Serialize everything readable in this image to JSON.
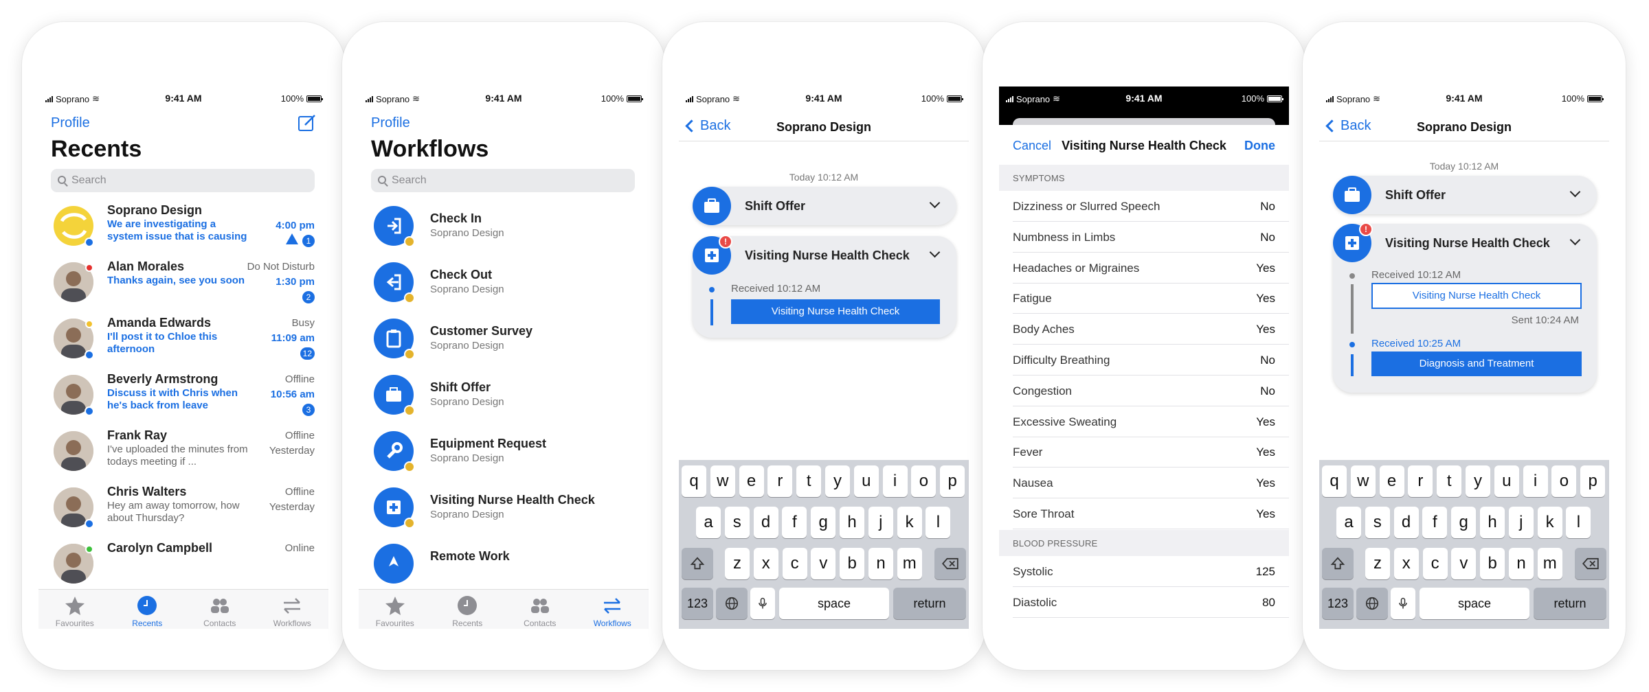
{
  "status": {
    "carrier": "Soprano",
    "time": "9:41 AM",
    "battery": "100%"
  },
  "recents": {
    "profile": "Profile",
    "title": "Recents",
    "search_placeholder": "Search",
    "conversations": [
      {
        "name": "Soprano Design",
        "status": "",
        "message": "We are investigating a system issue that is causing new ...",
        "time": "4:00 pm",
        "count": "1",
        "unread": true,
        "presence": "",
        "avatar": "soprano-logo"
      },
      {
        "name": "Alan Morales",
        "status": "Do Not Disturb",
        "message": "Thanks again, see you soon",
        "time": "1:30 pm",
        "count": "2",
        "unread": true,
        "presence": "#e5312e",
        "avatar": "person"
      },
      {
        "name": "Amanda Edwards",
        "status": "Busy",
        "message": "I'll post it to Chloe this afternoon",
        "time": "11:09 am",
        "count": "12",
        "unread": true,
        "presence": "#f2c12e",
        "avatar": "person"
      },
      {
        "name": "Beverly Armstrong",
        "status": "Offline",
        "message": "Discuss it with Chris when he's back from leave",
        "time": "10:56 am",
        "count": "3",
        "unread": true,
        "presence": "",
        "avatar": "person"
      },
      {
        "name": "Frank Ray",
        "status": "Offline",
        "message": "I've uploaded the minutes from todays meeting if ...",
        "time": "Yesterday",
        "count": "",
        "unread": false,
        "presence": "",
        "avatar": "person"
      },
      {
        "name": "Chris Walters",
        "status": "Offline",
        "message": "Hey am away tomorrow, how about Thursday?",
        "time": "Yesterday",
        "count": "",
        "unread": false,
        "presence": "",
        "avatar": "person"
      },
      {
        "name": "Carolyn Campbell",
        "status": "Online",
        "message": "",
        "time": "",
        "count": "",
        "unread": false,
        "presence": "#3cc13b",
        "avatar": "person"
      }
    ]
  },
  "tabs": [
    "Favourites",
    "Recents",
    "Contacts",
    "Workflows"
  ],
  "workflows": {
    "profile": "Profile",
    "title": "Workflows",
    "search_placeholder": "Search",
    "items": [
      {
        "name": "Check In",
        "sub": "Soprano Design",
        "icon": "check-in-icon"
      },
      {
        "name": "Check Out",
        "sub": "Soprano Design",
        "icon": "check-out-icon"
      },
      {
        "name": "Customer Survey",
        "sub": "Soprano Design",
        "icon": "clipboard-icon"
      },
      {
        "name": "Shift Offer",
        "sub": "Soprano Design",
        "icon": "briefcase-icon"
      },
      {
        "name": "Equipment Request",
        "sub": "Soprano Design",
        "icon": "wrench-icon"
      },
      {
        "name": "Visiting Nurse Health Check",
        "sub": "Soprano Design",
        "icon": "medical-icon"
      },
      {
        "name": "Remote Work",
        "sub": "",
        "icon": "location-icon"
      }
    ]
  },
  "chat": {
    "back": "Back",
    "title": "Soprano Design",
    "timestamp": "Today 10:12 AM",
    "shift_offer": "Shift Offer",
    "health_check": "Visiting Nurse Health Check",
    "alert": "!",
    "received1": "Received 10:12 AM",
    "button1": "Visiting Nurse Health Check",
    "sent": "Sent 10:24 AM",
    "received2": "Received 10:25 AM",
    "button2": "Diagnosis and Treatment"
  },
  "keyboard": {
    "row1": [
      "q",
      "w",
      "e",
      "r",
      "t",
      "y",
      "u",
      "i",
      "o",
      "p"
    ],
    "row2": [
      "a",
      "s",
      "d",
      "f",
      "g",
      "h",
      "j",
      "k",
      "l"
    ],
    "row3": [
      "z",
      "x",
      "c",
      "v",
      "b",
      "n",
      "m"
    ],
    "numbers": "123",
    "space": "space",
    "return": "return"
  },
  "form": {
    "cancel": "Cancel",
    "title": "Visiting Nurse Health Check",
    "done": "Done",
    "symptoms_header": "SYMPTOMS",
    "symptoms": [
      {
        "label": "Dizziness or Slurred Speech",
        "value": "No"
      },
      {
        "label": "Numbness in Limbs",
        "value": "No"
      },
      {
        "label": "Headaches or Migraines",
        "value": "Yes"
      },
      {
        "label": "Fatigue",
        "value": "Yes"
      },
      {
        "label": "Body Aches",
        "value": "Yes"
      },
      {
        "label": "Difficulty Breathing",
        "value": "No"
      },
      {
        "label": "Congestion",
        "value": "No"
      },
      {
        "label": "Excessive Sweating",
        "value": "Yes"
      },
      {
        "label": "Fever",
        "value": "Yes"
      },
      {
        "label": "Nausea",
        "value": "Yes"
      },
      {
        "label": "Sore Throat",
        "value": "Yes"
      }
    ],
    "bp_header": "BLOOD PRESSURE",
    "bp": [
      {
        "label": "Systolic",
        "value": "125"
      },
      {
        "label": "Diastolic",
        "value": "80"
      }
    ]
  },
  "colors": {
    "accent": "#1b6fe2",
    "alert": "#e94a47",
    "badge": "#e4b32c"
  }
}
